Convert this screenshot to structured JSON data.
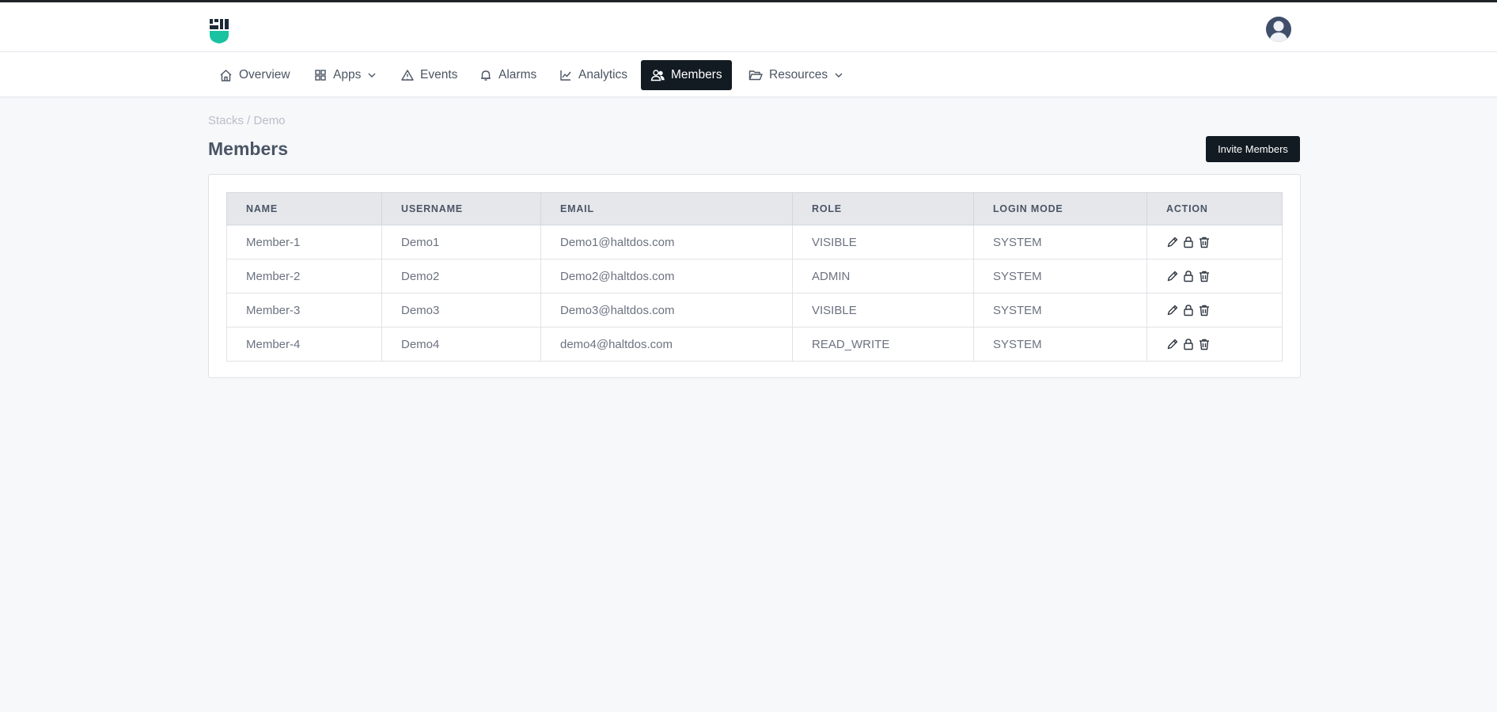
{
  "header": {
    "logo_icon": "fist-shield-logo",
    "avatar_icon": "user-avatar-icon"
  },
  "nav": {
    "items": [
      {
        "label": "Overview",
        "icon": "home-icon"
      },
      {
        "label": "Apps",
        "icon": "grid-icon",
        "dropdown": true
      },
      {
        "label": "Events",
        "icon": "warning-triangle-icon"
      },
      {
        "label": "Alarms",
        "icon": "bell-icon"
      },
      {
        "label": "Analytics",
        "icon": "line-chart-icon"
      },
      {
        "label": "Members",
        "icon": "users-icon",
        "active": true
      },
      {
        "label": "Resources",
        "icon": "folder-open-icon",
        "dropdown": true
      }
    ]
  },
  "breadcrumb": "Stacks / Demo",
  "page": {
    "title": "Members",
    "invite_label": "Invite Members"
  },
  "table": {
    "columns": [
      "NAME",
      "USERNAME",
      "EMAIL",
      "ROLE",
      "LOGIN MODE",
      "ACTION"
    ],
    "rows": [
      {
        "name": "Member-1",
        "username": "Demo1",
        "email": "Demo1@haltdos.com",
        "role": "VISIBLE",
        "login_mode": "SYSTEM"
      },
      {
        "name": "Member-2",
        "username": "Demo2",
        "email": "Demo2@haltdos.com",
        "role": "ADMIN",
        "login_mode": "SYSTEM"
      },
      {
        "name": "Member-3",
        "username": "Demo3",
        "email": "Demo3@haltdos.com",
        "role": "VISIBLE",
        "login_mode": "SYSTEM"
      },
      {
        "name": "Member-4",
        "username": "Demo4",
        "email": "demo4@haltdos.com",
        "role": "READ_WRITE",
        "login_mode": "SYSTEM"
      }
    ],
    "action_icons": [
      "pencil-icon",
      "lock-icon",
      "trash-icon"
    ]
  },
  "colors": {
    "accent_dark": "#121a22",
    "logo_teal": "#19c2a0",
    "page_bg": "#f7f8fa"
  }
}
